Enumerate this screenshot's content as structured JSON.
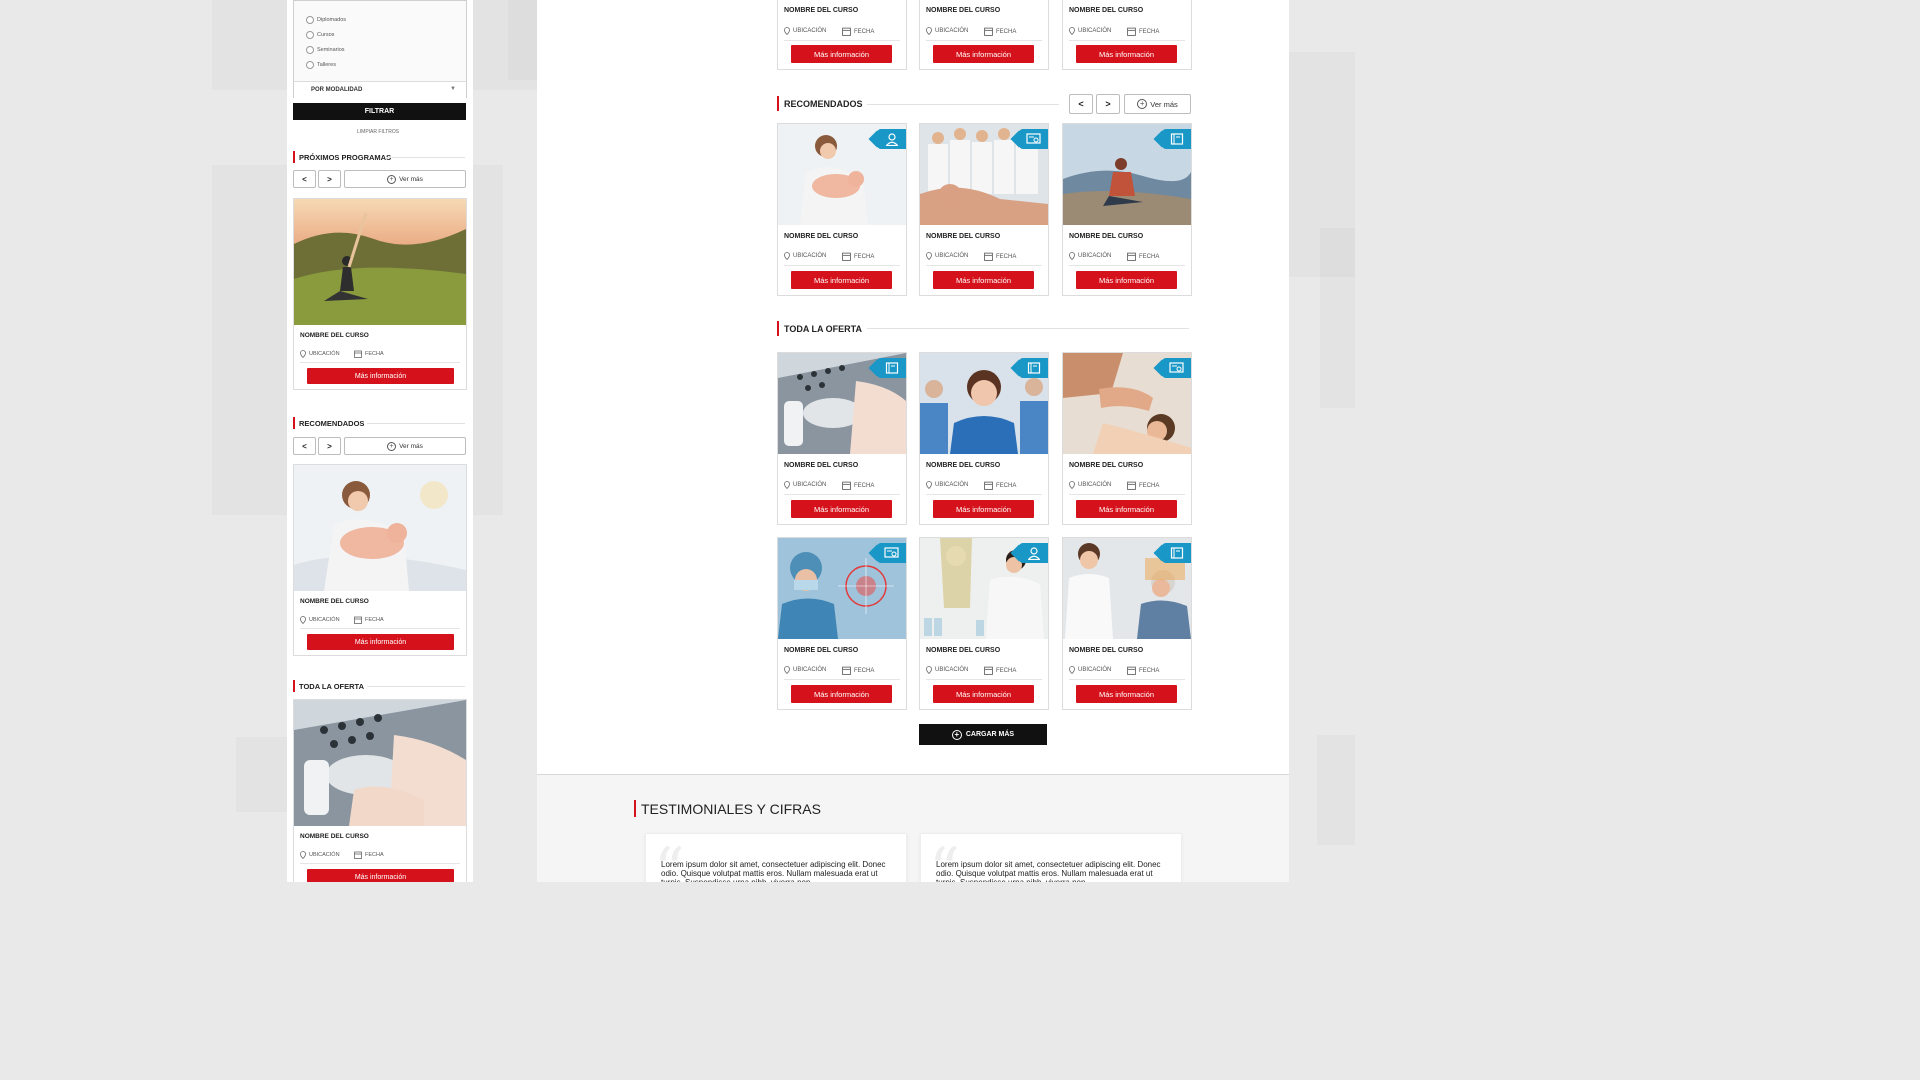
{
  "colors": {
    "accent_red": "#d5121b",
    "badge_blue": "#1997c6",
    "dark_button": "#111111"
  },
  "mobile": {
    "filter_options": [
      "Diplomados",
      "Cursos",
      "Seminarios",
      "Talleres"
    ],
    "modalidad_label": "POR MODALIDAD",
    "filter_button": "FILTRAR",
    "clear_filters": "LIMPIAR FILTROS",
    "sections": [
      {
        "title": "PRÓXIMOS PROGRAMAS",
        "prev": "<",
        "next": ">",
        "see_more": "Ver más"
      },
      {
        "title": "RECOMENDADOS",
        "prev": "<",
        "next": ">",
        "see_more": "Ver más"
      },
      {
        "title": "TODA LA OFERTA"
      }
    ],
    "cards": [
      {
        "name": "NOMBRE DEL CURSO",
        "location": "UBICACIÓN",
        "date": "FECHA",
        "button": "Más información",
        "image": "woman-yoga-meadow"
      },
      {
        "name": "NOMBRE DEL CURSO",
        "location": "UBICACIÓN",
        "date": "FECHA",
        "button": "Más información",
        "image": "mother-newborn"
      },
      {
        "name": "NOMBRE DEL CURSO",
        "location": "UBICACIÓN",
        "date": "FECHA",
        "button": "Más información",
        "image": "ultrasound-machine"
      }
    ]
  },
  "desktop": {
    "top_row_cards": [
      {
        "name": "NOMBRE DEL CURSO",
        "location": "UBICACIÓN",
        "date": "FECHA",
        "button": "Más información"
      },
      {
        "name": "NOMBRE DEL CURSO",
        "location": "UBICACIÓN",
        "date": "FECHA",
        "button": "Más información"
      },
      {
        "name": "NOMBRE DEL CURSO",
        "location": "UBICACIÓN",
        "date": "FECHA",
        "button": "Más información"
      }
    ],
    "recomendados": {
      "title": "RECOMENDADOS",
      "prev": "<",
      "next": ">",
      "see_more": "Ver más",
      "cards": [
        {
          "name": "NOMBRE DEL CURSO",
          "location": "UBICACIÓN",
          "date": "FECHA",
          "button": "Más información",
          "image": "mother-newborn",
          "badge_icon": "person-icon"
        },
        {
          "name": "NOMBRE DEL CURSO",
          "location": "UBICACIÓN",
          "date": "FECHA",
          "button": "Más información",
          "image": "medical-team-mannequin",
          "badge_icon": "certificate-icon"
        },
        {
          "name": "NOMBRE DEL CURSO",
          "location": "UBICACIÓN",
          "date": "FECHA",
          "button": "Más información",
          "image": "woman-mountain-meditation",
          "badge_icon": "book-icon"
        }
      ]
    },
    "toda_la_oferta": {
      "title": "TODA LA OFERTA",
      "cards": [
        {
          "name": "NOMBRE DEL CURSO",
          "location": "UBICACIÓN",
          "date": "FECHA",
          "button": "Más información",
          "image": "ultrasound-machine",
          "badge_icon": "book-icon"
        },
        {
          "name": "NOMBRE DEL CURSO",
          "location": "UBICACIÓN",
          "date": "FECHA",
          "button": "Más información",
          "image": "smiling-nurse",
          "badge_icon": "book-icon"
        },
        {
          "name": "NOMBRE DEL CURSO",
          "location": "UBICACIÓN",
          "date": "FECHA",
          "button": "Más información",
          "image": "physiotherapy",
          "badge_icon": "certificate-icon"
        },
        {
          "name": "NOMBRE DEL CURSO",
          "location": "UBICACIÓN",
          "date": "FECHA",
          "button": "Más información",
          "image": "surgeons",
          "badge_icon": "certificate-icon"
        },
        {
          "name": "NOMBRE DEL CURSO",
          "location": "UBICACIÓN",
          "date": "FECHA",
          "button": "Más información",
          "image": "lab-researcher",
          "badge_icon": "person-icon"
        },
        {
          "name": "NOMBRE DEL CURSO",
          "location": "UBICACIÓN",
          "date": "FECHA",
          "button": "Más información",
          "image": "doctor-elderly-patient",
          "badge_icon": "book-icon"
        }
      ],
      "load_more": "CARGAR MÁS"
    },
    "testimonials": {
      "title": "TESTIMONIALES Y CIFRAS",
      "quote_mark": "“",
      "items": [
        {
          "text": "Lorem ipsum dolor sit amet, consectetuer adipiscing elit. Donec odio. Quisque volutpat mattis eros. Nullam malesuada erat ut turpis. Suspendisse urna nibh, viverra non,"
        },
        {
          "text": "Lorem ipsum dolor sit amet, consectetuer adipiscing elit. Donec odio. Quisque volutpat mattis eros. Nullam malesuada erat ut turpis. Suspendisse urna nibh, viverra non,"
        }
      ]
    }
  }
}
